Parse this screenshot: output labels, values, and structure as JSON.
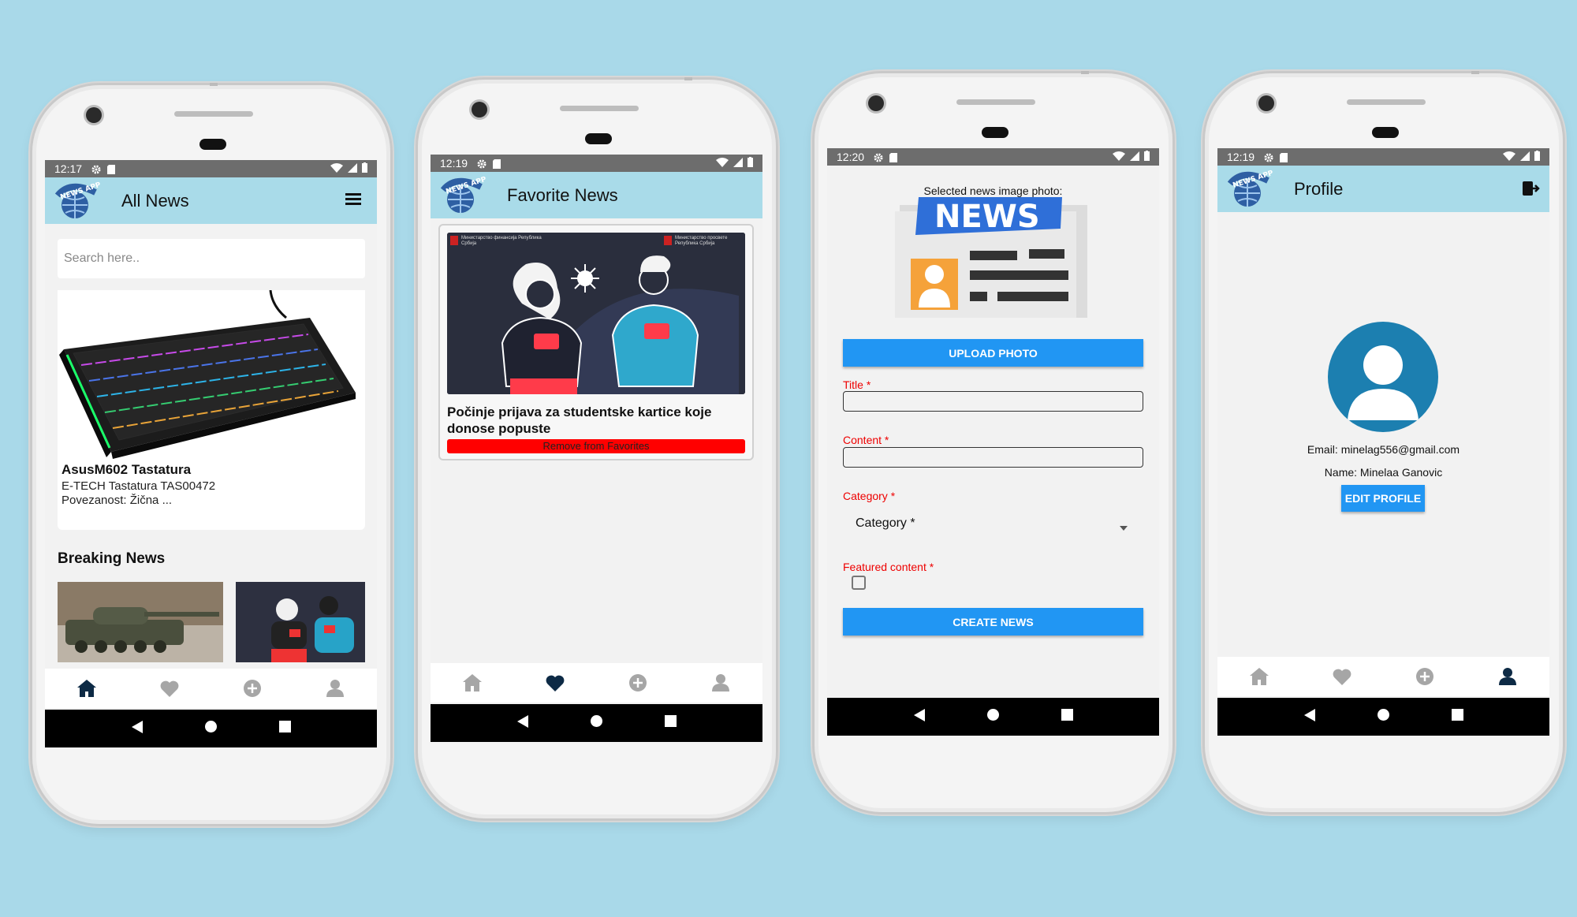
{
  "screens": {
    "all_news": {
      "status_time": "12:17",
      "title": "All News",
      "search_placeholder": "Search here..",
      "featured_title": "AsusM602 Tastatura",
      "featured_desc_1": "E-TECH Tastatura TAS00472",
      "featured_desc_2": "Povezanost: Žična ...",
      "breaking_heading": "Breaking News"
    },
    "favorites": {
      "status_time": "12:19",
      "title": "Favorite News",
      "news_title": "Počinje prijava za studentske kartice koje donose popuste",
      "remove_label": "Remove from Favorites",
      "image_caption_left": "Министарство финансија Република Србија",
      "image_caption_right": "Министарство просвете Република Србија"
    },
    "create": {
      "status_time": "12:20",
      "image_label": "Selected news image photo:",
      "news_image_text": "NEWS",
      "upload_label": "UPLOAD PHOTO",
      "title_label": "Title *",
      "content_label": "Content *",
      "category_label": "Category *",
      "category_value": "Category *",
      "featured_label": "Featured content *",
      "create_label": "CREATE NEWS"
    },
    "profile": {
      "status_time": "12:19",
      "title": "Profile",
      "email": "Email: minelag556@gmail.com",
      "name": "Name: Minelaa Ganovic",
      "edit_label": "EDIT PROFILE"
    }
  },
  "logo_text": "NEWS APP",
  "colors": {
    "appbar": "#a9dbe9",
    "accent": "#2196f3",
    "nav_active": "#0d2a45",
    "nav_inactive": "#a6a6a6",
    "danger": "#ff0000"
  }
}
